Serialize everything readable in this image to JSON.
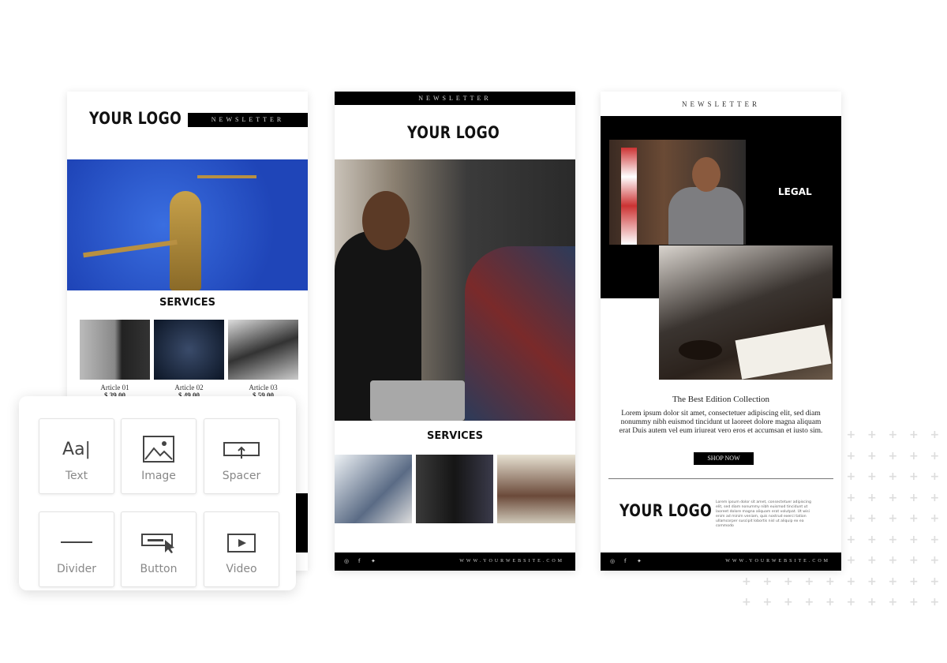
{
  "card1": {
    "logo": "YOUR LOGO",
    "newsletter": "NEWSLETTER",
    "services_title": "SERVICES",
    "articles": [
      {
        "title": "Article 01",
        "price": "$ 39.00"
      },
      {
        "title": "Article 02",
        "price": "$ 49.00"
      },
      {
        "title": "Article 03",
        "price": "$ 59.00"
      }
    ]
  },
  "widgets": [
    {
      "label": "Text",
      "icon": "text-icon"
    },
    {
      "label": "Image",
      "icon": "image-icon"
    },
    {
      "label": "Spacer",
      "icon": "spacer-icon"
    },
    {
      "label": "Divider",
      "icon": "divider-icon"
    },
    {
      "label": "Button",
      "icon": "button-icon"
    },
    {
      "label": "Video",
      "icon": "video-icon"
    }
  ],
  "card2": {
    "newsletter": "NEWSLETTER",
    "logo": "YOUR LOGO",
    "services_title": "SERVICES",
    "website": "WWW.YOURWEBSITE.COM"
  },
  "card3": {
    "newsletter": "NEWSLETTER",
    "legal": "LEGAL",
    "heading": "The Best Edition Collection",
    "body": "Lorem ipsum dolor sit amet, consectetuer adipiscing elit, sed diam nonummy nibh euismod tincidunt ut laoreet dolore magna aliquam erat Duis autem vel eum iriureat vero eros et accumsan et iusto sim.",
    "button": "SHOP NOW",
    "logo": "YOUR LOGO",
    "footer_text": "Lorem ipsum dolor sit amet, consectetuer adipiscing elit, sed diam nonummy nibh euismod tincidunt ut laoreet dolore magna aliquam erat volutpat. Ut wisi enim ad minim veniam, quis nostrud exerci tation ullamcorper suscipit lobortis nisl ut aliquip ex ea commodo",
    "website": "WWW.YOURWEBSITE.COM"
  },
  "social_icons": [
    "instagram-icon",
    "facebook-icon",
    "twitter-icon"
  ],
  "colors": {
    "hero_blue": "#2a55c8",
    "black": "#000000"
  }
}
